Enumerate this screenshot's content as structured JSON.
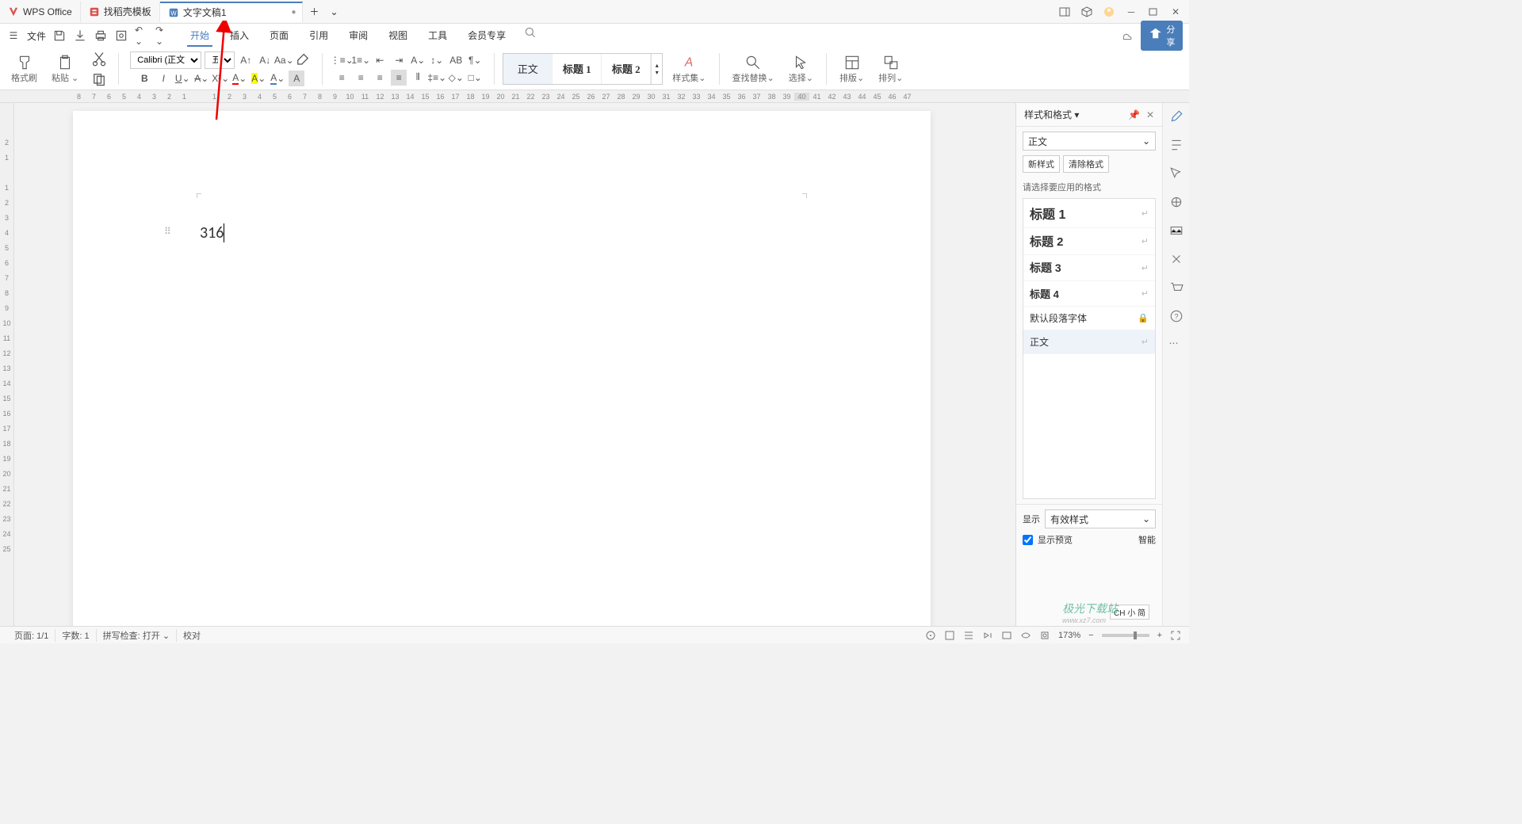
{
  "tabs": {
    "t0": {
      "label": "WPS Office"
    },
    "t1": {
      "label": "找稻壳模板"
    },
    "t2": {
      "label": "文字文稿1"
    }
  },
  "menu": {
    "file": "文件",
    "start": "开始",
    "insert": "插入",
    "page": "页面",
    "ref": "引用",
    "review": "审阅",
    "view": "视图",
    "tool": "工具",
    "member": "会员专享"
  },
  "share_label": "分享",
  "ribbon": {
    "format_painter": "格式刷",
    "paste": "粘贴",
    "font_name": "Calibri (正文)",
    "font_size": "五号",
    "styles_collection": "样式集",
    "find_replace": "查找替换",
    "select": "选择",
    "layout": "排版",
    "arrange": "排列",
    "style_normal": "正文",
    "style_h1": "标题 1",
    "style_h2": "标题 2"
  },
  "document": {
    "content": "316"
  },
  "panel": {
    "title": "样式和格式",
    "current_style": "正文",
    "new_style": "新样式",
    "clear_format": "清除格式",
    "hint": "请选择要应用的格式",
    "list": {
      "h1": "标题 1",
      "h2": "标题 2",
      "h3": "标题 3",
      "h4": "标题 4",
      "default_font": "默认段落字体",
      "normal": "正文"
    },
    "show_label": "显示",
    "show_value": "有效样式",
    "preview_check": "显示预览",
    "smart_label": "智能"
  },
  "status": {
    "page": "页面: 1/1",
    "words": "字数: 1",
    "spell": "拼写检查: 打开",
    "proof": "校对",
    "zoom": "173%",
    "ime": "CH 小 简"
  },
  "watermark": {
    "main": "极光下载站",
    "sub": "www.xz7.com"
  }
}
